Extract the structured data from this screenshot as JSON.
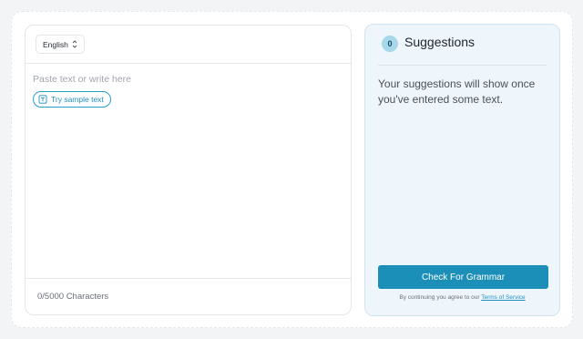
{
  "editor": {
    "language": "English",
    "placeholder": "Paste text or write here",
    "sample_button": "Try sample text",
    "char_count": "0/5000 Characters"
  },
  "suggestions": {
    "count": "0",
    "title": "Suggestions",
    "empty_message": "Your suggestions will show once you've entered some text.",
    "check_button": "Check For Grammar",
    "terms_prefix": "By continuing you agree to our",
    "terms_link": "Terms of Service"
  },
  "colors": {
    "accent": "#1b8fb8",
    "badge": "#a9d7ea",
    "panel_bg": "#eef6fc"
  }
}
